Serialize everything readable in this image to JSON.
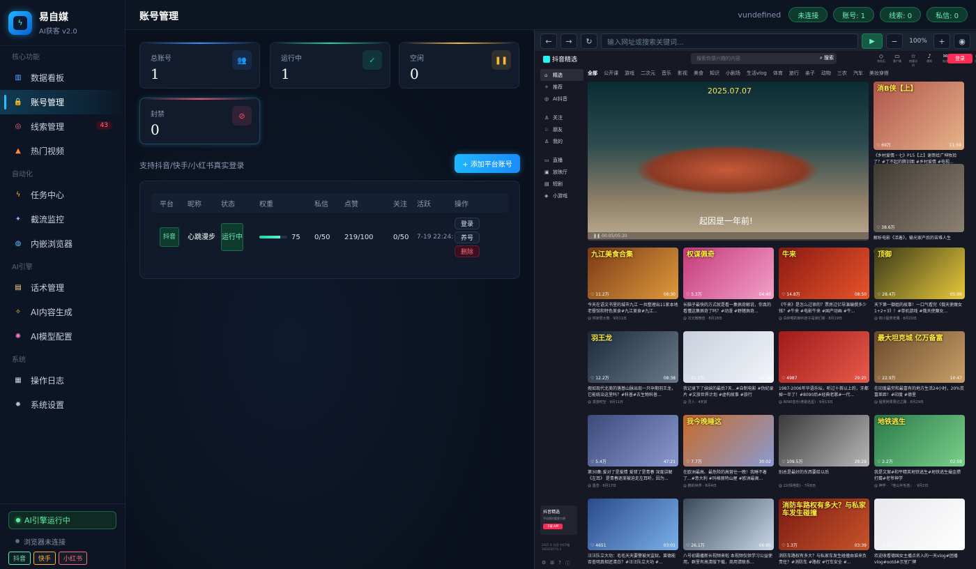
{
  "brand": {
    "name": "易自媒",
    "sub": "AI获客 v2.0"
  },
  "sidebar": {
    "sections": [
      {
        "title": "核心功能",
        "items": [
          {
            "label": "数据看板",
            "icon": "chart-icon",
            "glyph": "▥",
            "color": "#5aa9ff"
          },
          {
            "label": "账号管理",
            "icon": "lock-icon",
            "glyph": "🔒",
            "color": "#f6b73c",
            "active": true
          },
          {
            "label": "线索管理",
            "icon": "target-icon",
            "glyph": "◎",
            "color": "#ff6b7d",
            "badge": "43"
          },
          {
            "label": "热门视频",
            "icon": "fire-icon",
            "glyph": "▲",
            "color": "#ff8a3c"
          }
        ]
      },
      {
        "title": "自动化",
        "items": [
          {
            "label": "任务中心",
            "icon": "lightning-icon",
            "glyph": "ϟ",
            "color": "#ffb23c"
          },
          {
            "label": "截流监控",
            "icon": "satellite-icon",
            "glyph": "✦",
            "color": "#9aa8ff"
          },
          {
            "label": "内嵌浏览器",
            "icon": "globe-icon",
            "glyph": "◍",
            "color": "#5ac8ff"
          }
        ]
      },
      {
        "title": "AI引擎",
        "items": [
          {
            "label": "话术管理",
            "icon": "document-icon",
            "glyph": "▤",
            "color": "#ffd88a"
          },
          {
            "label": "AI内容生成",
            "icon": "sparkle-icon",
            "glyph": "✧",
            "color": "#ffd23c"
          },
          {
            "label": "AI模型配置",
            "icon": "brain-icon",
            "glyph": "✺",
            "color": "#ff7ad0"
          }
        ]
      },
      {
        "title": "系统",
        "items": [
          {
            "label": "操作日志",
            "icon": "clipboard-icon",
            "glyph": "▦",
            "color": "#d0d8e8"
          },
          {
            "label": "系统设置",
            "icon": "gear-icon",
            "glyph": "✹",
            "color": "#b6c2d6"
          }
        ]
      }
    ],
    "footer": {
      "ai_status": "AI引擎运行中",
      "browser_status": "浏览器未连接",
      "platforms": [
        {
          "label": "抖音",
          "color": "#5ff0a8"
        },
        {
          "label": "快手",
          "color": "#ffb23c"
        },
        {
          "label": "小红书",
          "color": "#ff6b7d"
        }
      ]
    }
  },
  "topbar": {
    "title": "账号管理",
    "user": "vundefined",
    "pills": [
      "未连接",
      "账号: 1",
      "线索: 0",
      "私信: 0"
    ]
  },
  "stats": [
    {
      "label": "总账号",
      "value": "1",
      "accent": "#3a8cff",
      "icon": "users-icon",
      "glyph": "👥"
    },
    {
      "label": "运行中",
      "value": "1",
      "accent": "#1fd6a0",
      "icon": "check-icon",
      "glyph": "✓"
    },
    {
      "label": "空闲",
      "value": "0",
      "accent": "#f6b73c",
      "icon": "pause-icon",
      "glyph": "❚❚"
    },
    {
      "label": "封禁",
      "value": "0",
      "accent": "#ff4d6d",
      "icon": "ban-icon",
      "glyph": "⊘"
    }
  ],
  "support_text": "支持抖音/快手/小红书真实登录",
  "add_button": "+ 添加平台账号",
  "table": {
    "columns": [
      "平台",
      "昵称",
      "状态",
      "权重",
      "私信",
      "点赞",
      "关注",
      "活跃",
      "操作"
    ],
    "rows": [
      {
        "platform": "抖音",
        "nickname": "心跳漫步",
        "status": "运行中",
        "weight": 75,
        "weight_text": "75",
        "dm": "0/50",
        "likes": "219/100",
        "follows": "0/50",
        "active": "7-19 22:24:",
        "ops": [
          "登录",
          "养号",
          "删除"
        ]
      }
    ]
  },
  "browser": {
    "url_placeholder": "输入网址或搜索关键词...",
    "zoom": "100%",
    "douyin": {
      "logo": "抖音精选",
      "search_placeholder": "搜索你感兴趣的内容",
      "search_btn": "搜索",
      "top_icons": [
        {
          "label": "充钻石",
          "glyph": "◇"
        },
        {
          "label": "客户端",
          "glyph": "▭"
        },
        {
          "label": "快捷访问",
          "glyph": "☆"
        },
        {
          "label": "通知",
          "glyph": "♪"
        },
        {
          "label": "私信",
          "glyph": "✉"
        },
        {
          "label": "投稿",
          "glyph": "▽"
        },
        {
          "label": "设置",
          "glyph": "≡"
        }
      ],
      "login": "登录",
      "left_nav": [
        {
          "label": "精选",
          "glyph": "⌂",
          "active": true
        },
        {
          "label": "推荐",
          "glyph": "✧"
        },
        {
          "label": "AI抖音",
          "glyph": "◎"
        },
        {
          "label": "",
          "glyph": ""
        },
        {
          "label": "关注",
          "glyph": "♙"
        },
        {
          "label": "朋友",
          "glyph": "♘"
        },
        {
          "label": "我的",
          "glyph": "♙"
        },
        {
          "label": "",
          "glyph": ""
        },
        {
          "label": "直播",
          "glyph": "▭"
        },
        {
          "label": "放映厅",
          "glyph": "▣"
        },
        {
          "label": "短剧",
          "glyph": "▤"
        },
        {
          "label": "小游戏",
          "glyph": "◈"
        }
      ],
      "categories": [
        "全部",
        "公开课",
        "游戏",
        "二次元",
        "音乐",
        "影视",
        "美食",
        "知识",
        "小剧场",
        "生活vlog",
        "体育",
        "旅行",
        "亲子",
        "动物",
        "三农",
        "汽车",
        "美妆穿搭"
      ],
      "hero": {
        "date": "2025.07.07",
        "subtitle": "起因是一年前!",
        "time": "00:05/05:20"
      },
      "side_videos": [
        {
          "caption": "消B侠【上】",
          "likes": "69万",
          "dur": "11:59",
          "title": "《乡村爱情・七》P15【上】谢哥给广坤牧拾了？#丁不起的腾训面 #乡村爱情 #电视...",
          "meta": "@ 腾笔大爷子 · 9月13日",
          "bg": "linear-gradient(135deg,#b0544a,#e7b48a)"
        },
        {
          "caption": "",
          "likes": "38.6万",
          "dur": "",
          "title": "解析电影《活着》，输光家产后的苦难人生",
          "meta": "@ 李牧电影 · 7月9日",
          "bg": "linear-gradient(135deg,#3f3a33,#8c8172)"
        }
      ],
      "videos": [
        {
          "caption": "九江美食合集",
          "likes": "11.2万",
          "dur": "08:30",
          "title": "今天在语文书里的城市九江 一共整理出11家本地老餐馆和特色美食#九江美食#九江...",
          "meta": "@ 林家很大熊 · 9月11日",
          "bg": "linear-gradient(135deg,#7a3a18,#e09a3a)"
        },
        {
          "caption": "权谋佩奇",
          "likes": "5.3万",
          "dur": "04:40",
          "title": "长脑子最快的方式就是看一集佩奇解说，你真的看懂这集佩奇了吗？#动漫 #野猪佩奇...",
          "meta": "@ 次元微微佳 · 8月18日",
          "bg": "linear-gradient(135deg,#c53a7a,#f2a0c8)"
        },
        {
          "caption": "牛来",
          "likes": "14.8万",
          "dur": "08:50",
          "title": "《牛来》是怎么过审的？票房过亿导演编撰多少钱？#牛来 #电影牛来 #国产动画 #牛...",
          "meta": "@ 白醉哪的喇叭娃子是谁们谢 · 8月19日",
          "bg": "linear-gradient(135deg,#8a1a12,#e8542a)"
        },
        {
          "caption": "顶御",
          "likes": "28.4万",
          "dur": "05:09",
          "title": "天下第一御姐的故事！一口气看完《俄天使魔女1+2+3》！#单机游戏 #俄天使魔女...",
          "meta": "@ 四川猛男老鹰 · 8月20日",
          "bg": "linear-gradient(135deg,#3a3a1a,#e8c83a)"
        },
        {
          "caption": "羽王龙",
          "likes": "12.2万",
          "dur": "08:38",
          "title": "假如现代北美的落基山脉出现一只孕期羽王龙，它能统治这里吗？#科普#古生物科普...",
          "meta": "@ 漫游时空 · 9月11日",
          "bg": "linear-gradient(135deg,#1a2a3a,#6a7a8a)"
        },
        {
          "caption": "",
          "likes": "51.2万",
          "dur": "06:38",
          "title": "我记录下了妹妹的最后7天...#自制电影 #伪纪录片 #文旅世界计划 #虚构故事 #旅行",
          "meta": "@ 灵人 · 4天前",
          "bg": "linear-gradient(135deg,#c8d0dc,#f2f4f8)"
        },
        {
          "caption": "",
          "likes": "4987",
          "dur": "29:25",
          "title": "1987-2006年华语乐坛，听过十首以上的，牙都掉一半了！#8090后#经典老歌#一代...",
          "meta": "@ 8090音乐(老歌名星) · 9月13日",
          "bg": "linear-gradient(135deg,#a01a1a,#e85a4a)"
        },
        {
          "caption": "最大坦克城 亿万备富",
          "likes": "22.9万",
          "dur": "10:47",
          "title": "在印度最穷和最富有的地方生活24小时，20%贫富差距！#印度 #德里",
          "meta": "@ 猛男阿周周记之路 · 8月29日",
          "bg": "linear-gradient(135deg,#6a4a2a,#c8a06a)"
        },
        {
          "caption": "",
          "likes": "5.4万",
          "dur": "47:21",
          "title": "第30集:爱对了是爱情 爱错了是青春 深度讲解《左耳》 是青春逐渐被迫走左耳听，因为...",
          "meta": "@ 墨念 · 8月17日",
          "bg": "linear-gradient(135deg,#3a4a7a,#8a9ad0)"
        },
        {
          "caption": "我今晚睡这",
          "likes": "7.7万",
          "dur": "30:02",
          "title": "在欧洲最高、最危险的高营住一晚！我睡不着了...#意大利 #玛格丽特山屋 #欧洲最高...",
          "meta": "@ 鹏的世界 · 8月4日",
          "bg": "linear-gradient(135deg,#c86a2a,#8a9ad0)"
        },
        {
          "caption": "",
          "likes": "109.5万",
          "dur": "28:29",
          "title": "别总是最好的东西要给以后",
          "meta": "@ 22(情电影) · 7月8日",
          "bg": "linear-gradient(135deg,#3a3a3a,#b8b8b8)"
        },
        {
          "caption": "地铁逃生",
          "likes": "2.2万",
          "dur": "02:59",
          "title": "我是文案#和平精英地铁逃生#地铁逃生撮金攒打薅#老爷神学",
          "meta": "@ 神学 · 『他山半毛意』 · 9月2日",
          "bg": "linear-gradient(135deg,#2a7a4a,#7ad08a)"
        },
        {
          "caption": "",
          "likes": "4651",
          "dur": "03:01",
          "title": "汪汪队立大功：毛毛天天要警被关监狱，莱德能否查明真相还清白？#汪汪队立大功 #...",
          "meta": "",
          "bg": "linear-gradient(135deg,#2a4a8a,#7ab0e8)"
        },
        {
          "caption": "",
          "likes": "26.1万",
          "dur": "06:00",
          "title": "八号初霸播新长视频来啦 本视频仅供学习公益使用，群里有高清版下载，商用请联系...",
          "meta": "",
          "bg": "linear-gradient(135deg,#3a4a5a,#c8d8e8)"
        },
        {
          "caption": "消防车路权有多大？与私家车发生碰撞",
          "likes": "1.3万",
          "dur": "03:39",
          "title": "消防车路权有多大？与私家车发生碰撞由谁来负责任？#消防车 #路权 #行车安全 #...",
          "meta": "",
          "bg": "linear-gradient(135deg,#7a1a12,#c8542a)"
        },
        {
          "caption": "",
          "likes": "3.3万",
          "dur": "03:27",
          "title": "欢迎收看德国女主播点名入的一天vlog#团播vlog#ootd#示室厂牌",
          "meta": "",
          "bg": "linear-gradient(135deg,#e8e8ec,#ffffff)"
        }
      ],
      "app_card": {
        "title": "抖音精选",
        "sub": "手机随时看更方便",
        "btn": "下载 APP"
      },
      "copyright": "2025 © 抖音 京ICP备16016397号-3"
    }
  }
}
